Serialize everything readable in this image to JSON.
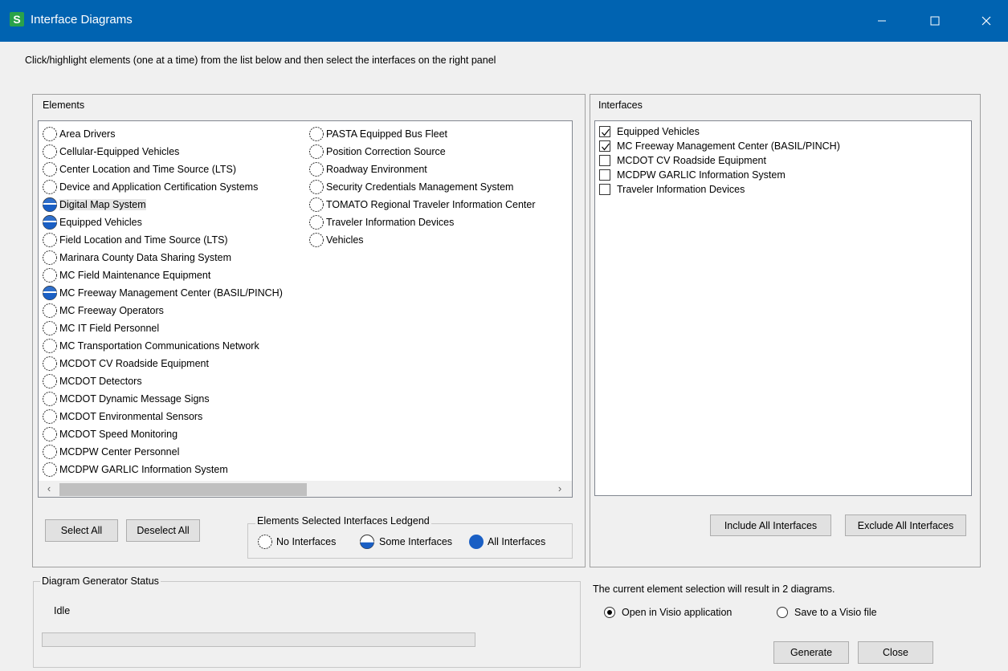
{
  "window": {
    "title": "Interface Diagrams",
    "app_icon_letter": "S",
    "titlebar_color": "#0063b1"
  },
  "instruction": "Click/highlight elements (one at a time) from the list below and then select the interfaces on the right panel",
  "elements_panel": {
    "label": "Elements",
    "items": [
      {
        "label": "Area Drivers",
        "status": "none"
      },
      {
        "label": "Cellular-Equipped Vehicles",
        "status": "none"
      },
      {
        "label": "Center Location and Time Source (LTS)",
        "status": "none"
      },
      {
        "label": "Device and Application Certification Systems",
        "status": "none"
      },
      {
        "label": "Digital Map System",
        "status": "some",
        "selected": true
      },
      {
        "label": "Equipped Vehicles",
        "status": "some"
      },
      {
        "label": "Field Location and Time Source (LTS)",
        "status": "none"
      },
      {
        "label": "Marinara County Data Sharing System",
        "status": "none"
      },
      {
        "label": "MC Field Maintenance Equipment",
        "status": "none"
      },
      {
        "label": "MC Freeway Management Center (BASIL/PINCH)",
        "status": "some"
      },
      {
        "label": "MC Freeway Operators",
        "status": "none"
      },
      {
        "label": "MC IT Field Personnel",
        "status": "none"
      },
      {
        "label": "MC Transportation Communications Network",
        "status": "none"
      },
      {
        "label": "MCDOT CV Roadside Equipment",
        "status": "none"
      },
      {
        "label": "MCDOT Detectors",
        "status": "none"
      },
      {
        "label": "MCDOT Dynamic Message Signs",
        "status": "none"
      },
      {
        "label": "MCDOT Environmental Sensors",
        "status": "none"
      },
      {
        "label": "MCDOT Speed Monitoring",
        "status": "none"
      },
      {
        "label": "MCDPW Center Personnel",
        "status": "none"
      },
      {
        "label": "MCDPW GARLIC Information System",
        "status": "none"
      },
      {
        "label": "PASTA Equipped Bus Fleet",
        "status": "none"
      },
      {
        "label": "Position Correction Source",
        "status": "none"
      },
      {
        "label": "Roadway Environment",
        "status": "none"
      },
      {
        "label": "Security Credentials Management System",
        "status": "none"
      },
      {
        "label": "TOMATO Regional Traveler Information Center",
        "status": "none"
      },
      {
        "label": "Traveler Information Devices",
        "status": "none"
      },
      {
        "label": "Vehicles",
        "status": "none"
      }
    ],
    "select_all_label": "Select All",
    "deselect_all_label": "Deselect All",
    "legend": {
      "title": "Elements Selected Interfaces Ledgend",
      "none_label": "No Interfaces",
      "some_label": "Some Interfaces",
      "all_label": "All Interfaces"
    }
  },
  "interfaces_panel": {
    "label": "Interfaces",
    "items": [
      {
        "label": "Equipped Vehicles",
        "checked": true
      },
      {
        "label": "MC Freeway Management Center (BASIL/PINCH)",
        "checked": true
      },
      {
        "label": "MCDOT CV Roadside Equipment",
        "checked": false
      },
      {
        "label": "MCDPW GARLIC Information System",
        "checked": false
      },
      {
        "label": "Traveler Information Devices",
        "checked": false
      }
    ],
    "include_all_label": "Include All Interfaces",
    "exclude_all_label": "Exclude All Interfaces"
  },
  "status_panel": {
    "label": "Diagram Generator Status",
    "status_text": "Idle",
    "progress": 0
  },
  "output": {
    "summary": "The current element selection will result in 2 diagrams.",
    "options": [
      {
        "label": "Open in Visio application",
        "selected": true
      },
      {
        "label": "Save to a Visio file",
        "selected": false
      }
    ],
    "generate_label": "Generate",
    "close_label": "Close"
  },
  "colors": {
    "indicator_fill": "#1a5fc4",
    "selection_bg": "#e5e5e5"
  }
}
